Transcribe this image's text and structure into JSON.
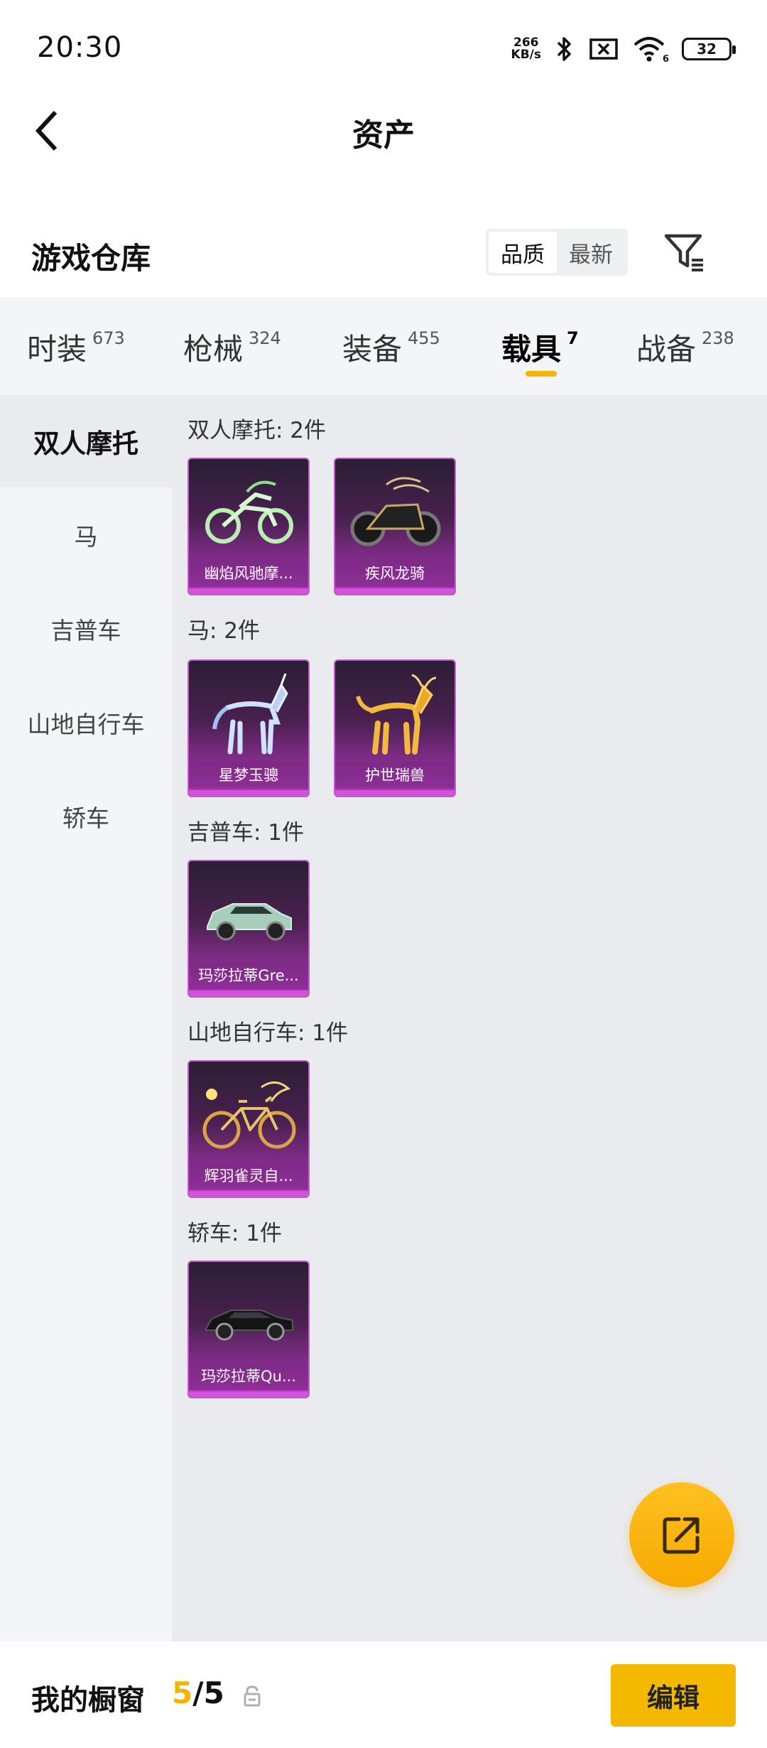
{
  "status_bar": {
    "time": "20:30",
    "net_speed_value": "266",
    "net_speed_unit": "KB/s",
    "wifi_badge": "6",
    "battery": "32"
  },
  "header": {
    "title": "资产"
  },
  "warehouse": {
    "title": "游戏仓库",
    "sort_options": [
      "品质",
      "最新"
    ],
    "sort_selected": "品质"
  },
  "tabs": [
    {
      "label": "时装",
      "count": "673"
    },
    {
      "label": "枪械",
      "count": "324"
    },
    {
      "label": "装备",
      "count": "455"
    },
    {
      "label": "载具",
      "count": "7",
      "active": true
    },
    {
      "label": "战备",
      "count": "238"
    }
  ],
  "sidebar": {
    "items": [
      "双人摩托",
      "马",
      "吉普车",
      "山地自行车",
      "轿车"
    ],
    "active": "双人摩托"
  },
  "sections": [
    {
      "title": "双人摩托: 2件",
      "items": [
        {
          "name": "幽焰风驰摩...",
          "icon": "motorcycle-icon"
        },
        {
          "name": "疾风龙骑",
          "icon": "motorcycle-icon"
        }
      ]
    },
    {
      "title": "马: 2件",
      "items": [
        {
          "name": "星梦玉骢",
          "icon": "horse-icon"
        },
        {
          "name": "护世瑞兽",
          "icon": "horse-icon"
        }
      ]
    },
    {
      "title": "吉普车: 1件",
      "items": [
        {
          "name": "玛莎拉蒂Gre...",
          "icon": "suv-icon"
        }
      ]
    },
    {
      "title": "山地自行车: 1件",
      "items": [
        {
          "name": "辉羽雀灵自...",
          "icon": "bicycle-icon"
        }
      ]
    },
    {
      "title": "轿车: 1件",
      "items": [
        {
          "name": "玛莎拉蒂Qu...",
          "icon": "sedan-icon"
        }
      ]
    }
  ],
  "bottom_bar": {
    "title": "我的橱窗",
    "count_used": "5",
    "count_sep": "/",
    "count_total": "5",
    "edit_label": "编辑"
  },
  "colors": {
    "accent": "#f5b400",
    "card_purple": "#8e2f96",
    "panel_bg": "#e9ebef"
  }
}
